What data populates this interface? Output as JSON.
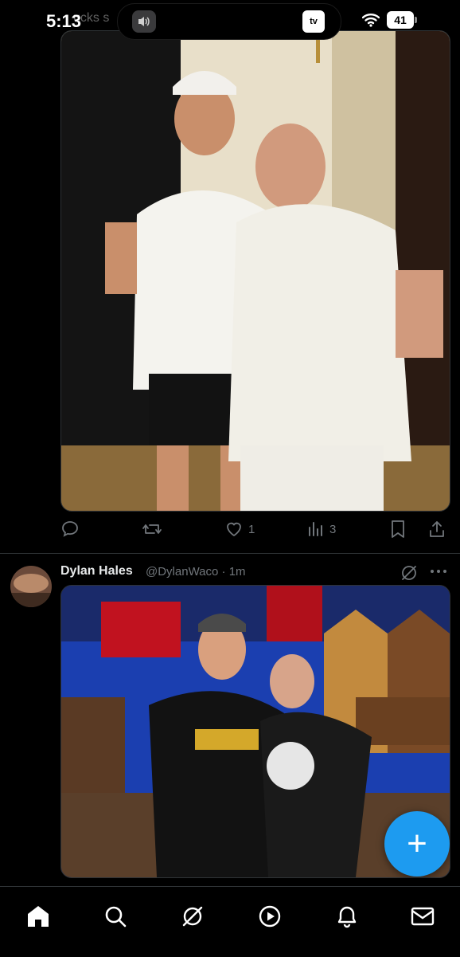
{
  "status_bar": {
    "time": "5:13",
    "behind_text": "ucks s",
    "island_app_label": "tv",
    "battery": "41"
  },
  "tweet1": {
    "media_description": "photo",
    "actions": {
      "reply_count": "",
      "repost_count": "",
      "like_count": "1",
      "views_count": "3"
    }
  },
  "tweet2": {
    "name": "Dylan Hales",
    "handle_time": "@DylanWaco · 1m"
  },
  "fab": {
    "label": "+"
  },
  "tabbar": {
    "items": [
      "home-icon",
      "search-icon",
      "grok-icon",
      "video-icon",
      "notifications-icon",
      "messages-icon"
    ]
  },
  "colors": {
    "background": "#000000",
    "accent": "#1d9bf0",
    "muted": "#71767b",
    "divider": "#2f3336"
  }
}
